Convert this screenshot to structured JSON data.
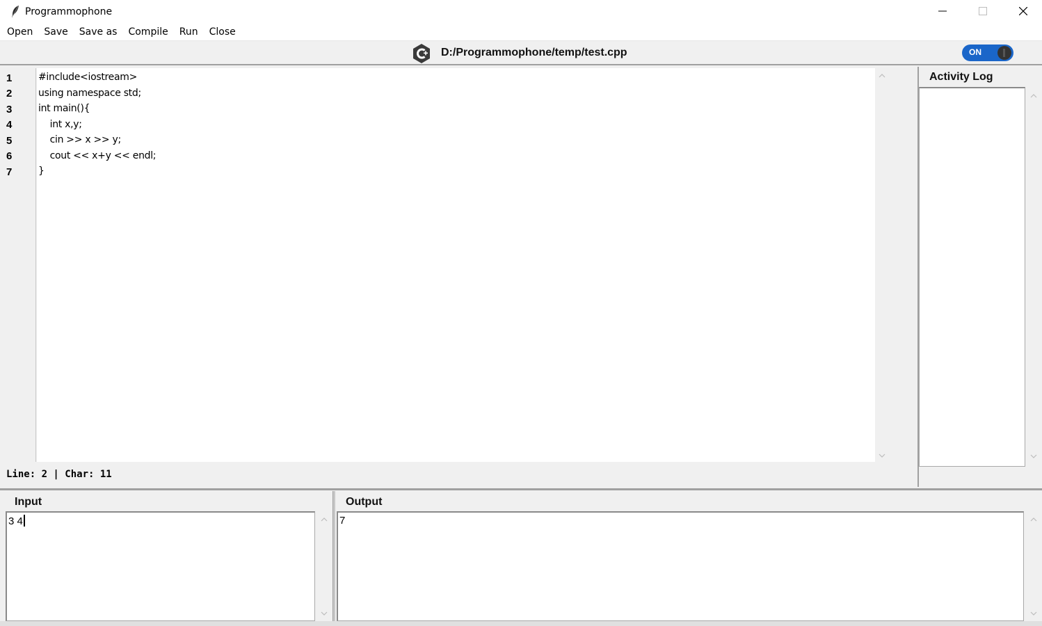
{
  "window": {
    "title": "Programmophone",
    "controls": {
      "minimize": "minimize-icon",
      "maximize": "maximize-icon",
      "close": "close-icon"
    }
  },
  "menu": {
    "items": [
      "Open",
      "Save",
      "Save as",
      "Compile",
      "Run",
      "Close"
    ]
  },
  "file": {
    "path": "D:/Programmophone/temp/test.cpp",
    "language_icon": "cpp-logo-icon",
    "toggle_label": "ON",
    "toggle_state": true
  },
  "editor": {
    "line_numbers": [
      "1",
      "2",
      "3",
      "4",
      "5",
      "6",
      "7"
    ],
    "lines": [
      "#include<iostream>",
      "using namespace std;",
      "int main(){",
      "    int x,y;",
      "    cin >> x >> y;",
      "    cout << x+y << endl;",
      "}"
    ],
    "status": "Line: 2 | Char: 11"
  },
  "activity_log": {
    "title": "Activity Log",
    "entries": []
  },
  "input": {
    "title": "Input",
    "value": "3 4"
  },
  "output": {
    "title": "Output",
    "value": "7"
  },
  "colors": {
    "toggle_on": "#1a66c9",
    "background": "#f0f0f0"
  }
}
